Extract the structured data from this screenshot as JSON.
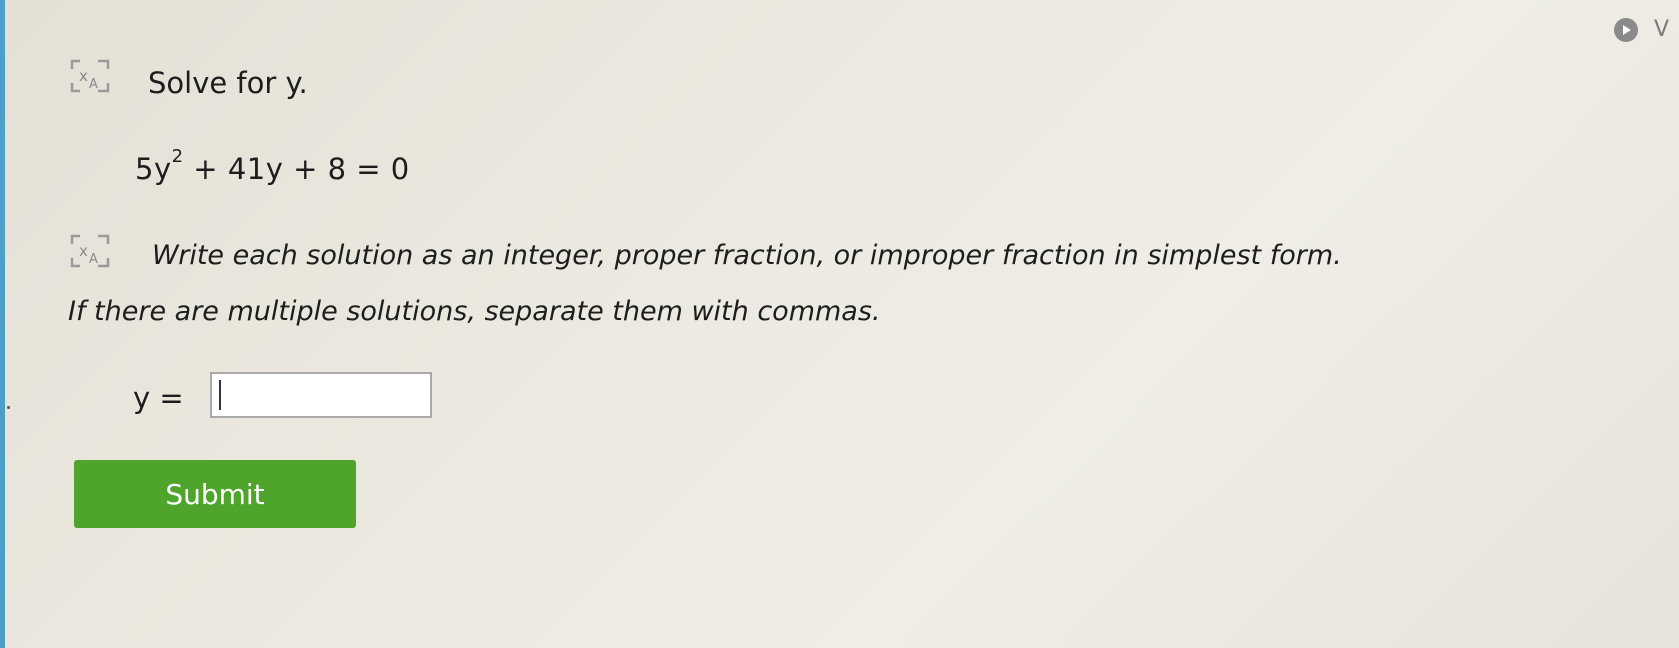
{
  "header": {
    "corner_letter": "V",
    "corner_icon": "play-circle-icon"
  },
  "question": {
    "prompt": "Solve for y.",
    "equation": {
      "lhs_coef": "5y",
      "exponent": "2",
      "rest": " + 41y + 8 = 0"
    },
    "instruction_line1": "Write each solution as an integer, proper fraction, or improper fraction in simplest form.",
    "instruction_line2": "If there are multiple solutions, separate them with commas."
  },
  "answer": {
    "label": "y =",
    "value": "",
    "placeholder": ""
  },
  "submit": {
    "label": "Submit"
  },
  "icons": {
    "translate": "translate-icon"
  },
  "colors": {
    "submit_bg": "#4fa52c",
    "submit_text": "#ffffff",
    "page_bg": "#ebe8df"
  }
}
